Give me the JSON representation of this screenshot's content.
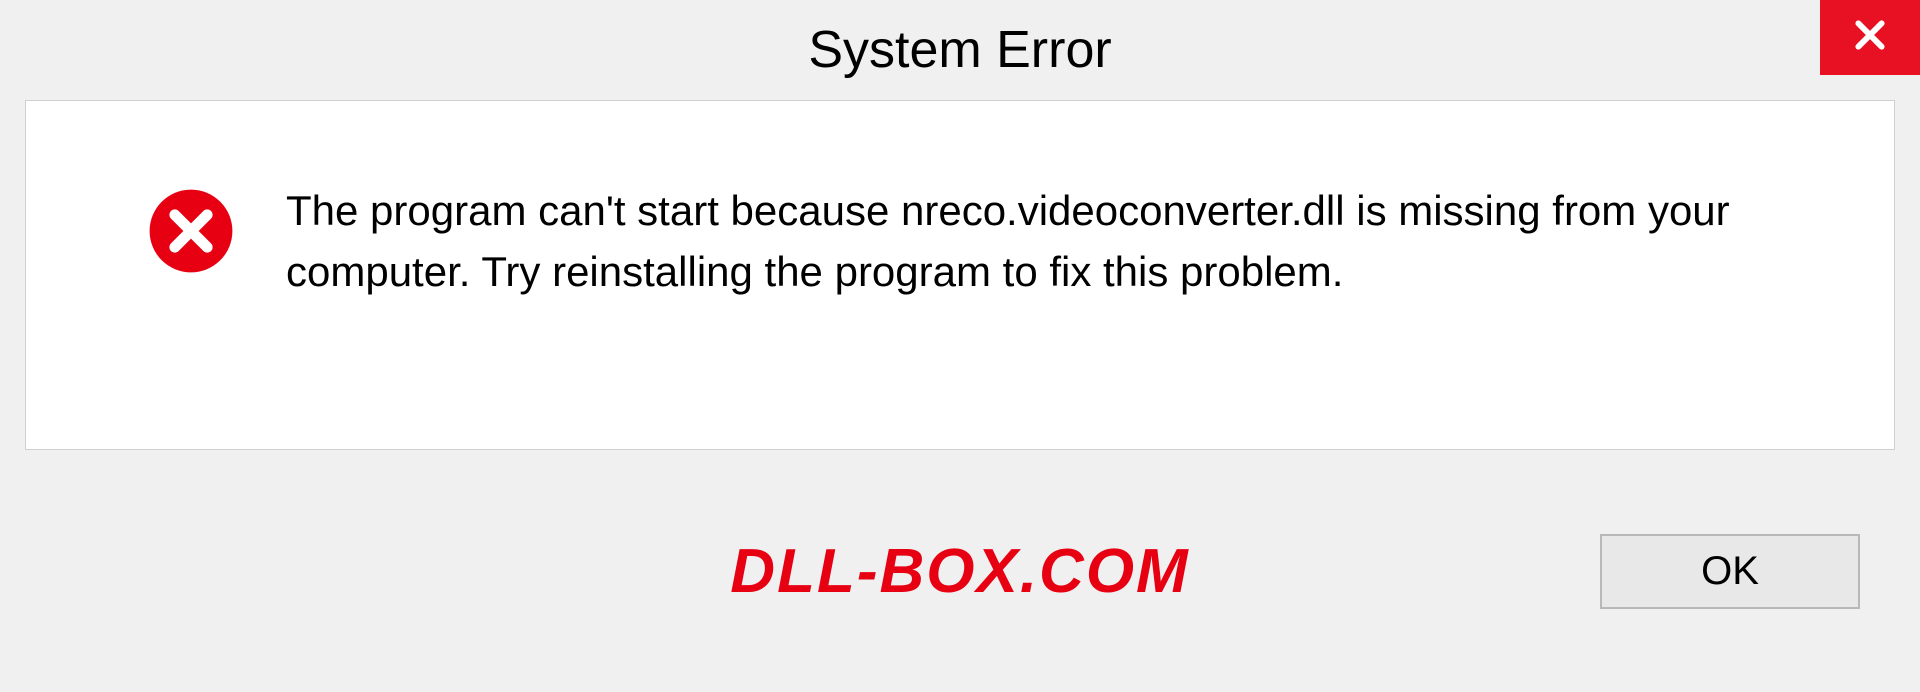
{
  "dialog": {
    "title": "System Error",
    "message": "The program can't start because nreco.videoconverter.dll is missing from your computer. Try reinstalling the program to fix this problem.",
    "ok_label": "OK"
  },
  "watermark": "DLL-BOX.COM"
}
